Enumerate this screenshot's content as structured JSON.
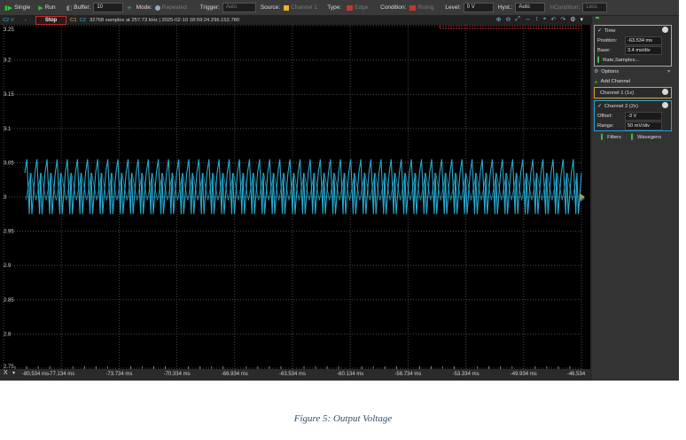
{
  "toolbar": {
    "single_label": "Single",
    "run_label": "Run",
    "buffer_label": "Buffer:",
    "buffer_value": "10",
    "mode_label": "Mode:",
    "mode_value": "Repeated",
    "trigger_label": "Trigger:",
    "trigger_value": "Auto",
    "source_label": "Source:",
    "source_value": "Channel 1",
    "type_label": "Type:",
    "type_value": "Edge",
    "condition_label": "Condition:",
    "condition_value": "Rising",
    "level_label": "Level:",
    "level_value": "0 V",
    "hyst_label": "Hyst.:",
    "hyst_value": "Auto",
    "hyst_condition_label": "HCondition:",
    "hyst_condition_value": "Less"
  },
  "status": {
    "channel_unit": "C2 V",
    "stop_label": "Stop",
    "c1_label": "C1",
    "c2_label": "C2",
    "info": "32768 samples at 257.73 kHz | 2025-02-10 18:59:24.296.152.780"
  },
  "panel": {
    "time": {
      "title": "Time",
      "position_label": "Position:",
      "position_value": "-63.534 ms",
      "base_label": "Base:",
      "base_value": "3.4 ms/div",
      "rate_label": "Rate,Samples..."
    },
    "options_label": "Options",
    "add_channel_label": "Add Channel",
    "channel1_label": "Channel 1 (1x)",
    "channel2": {
      "title": "Channel 2 (2x)",
      "offset_label": "Offset:",
      "offset_value": "-3 V",
      "range_label": "Range:",
      "range_value": "50 mV/div"
    },
    "filters_label": "Filters",
    "wavegens_label": "Wavegens"
  },
  "caption": "Figure 5: Output Voltage",
  "colors": {
    "trace": "#27a9cf",
    "channel1_accent": "#e0a020",
    "channel2_accent": "#2aa0d8",
    "stop_border": "#c02a2a",
    "plot_background": "#000000",
    "grid": "#4a4a4a"
  },
  "chart_data": {
    "type": "line",
    "grid": true,
    "ylim": [
      2.75,
      3.25
    ],
    "xlim": [
      -80.534,
      -46.534
    ],
    "y_ticks": [
      "3.25",
      "3.2",
      "3.15",
      "3.1",
      "3.05",
      "3",
      "2.95",
      "2.9",
      "2.85",
      "2.8",
      "2.75"
    ],
    "x_ticks": [
      "-80.534 ms",
      "-77.134 ms",
      "-73.734 ms",
      "-70.334 ms",
      "-66.934 ms",
      "-63.534 ms",
      "-60.134 ms",
      "-56.734 ms",
      "-53.334 ms",
      "-49.934 ms",
      "-46.534"
    ],
    "series": [
      {
        "periods": 55,
        "envelope_max": 3.055,
        "envelope_min": 2.975,
        "inner_max": 3.035,
        "inner_min": 2.995,
        "mean": 3.0
      }
    ]
  }
}
